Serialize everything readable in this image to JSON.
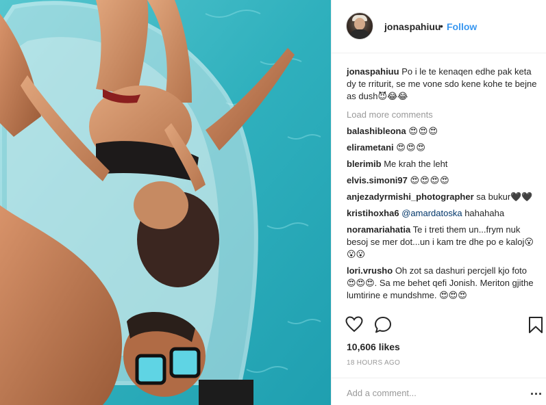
{
  "post": {
    "username": "jonaspahiuu",
    "dot": "•",
    "follow_label": "Follow",
    "caption_text": "Po i le te kenaqen edhe pak keta dy te rriturit, se me vone sdo kene kohe te bejne as dush😈😂😂",
    "load_more": "Load more comments",
    "likes": "10,606 likes",
    "time": "18 HOURS AGO",
    "add_comment_placeholder": "Add a comment...",
    "more_menu": "..."
  },
  "comments": [
    {
      "user": "balashibleona",
      "text": "😍😍😍"
    },
    {
      "user": "elirametani",
      "text": "😍😍😍"
    },
    {
      "user": "blerimib",
      "text": "Me krah the leht"
    },
    {
      "user": "elvis.simoni97",
      "text": "😍😍😍😍"
    },
    {
      "user": "anjezadyrmishi_photographer",
      "text": "sa bukur🖤🖤"
    },
    {
      "user": "kristihoxha6",
      "mention": "@amardatoska",
      "text": "hahahaha"
    },
    {
      "user": "noramariahatia",
      "text": "Te i treti them un...frym nuk besoj se mer dot...un i kam tre dhe po e kaloj😮😮😮"
    },
    {
      "user": "lori.vrusho",
      "text": "Oh zot sa dashuri percjell kjo foto 😍😍😍. Sa me behet qefi Jonish. Meriton gjithe lumtirine e mundshme. 😍😍😍"
    }
  ],
  "icons": {
    "like": "heart-outline-icon",
    "comment": "speech-bubble-icon",
    "save": "bookmark-icon"
  },
  "colors": {
    "link_blue": "#3897f0",
    "pool_water": "#3fb8c2",
    "muted_text": "#999999"
  }
}
